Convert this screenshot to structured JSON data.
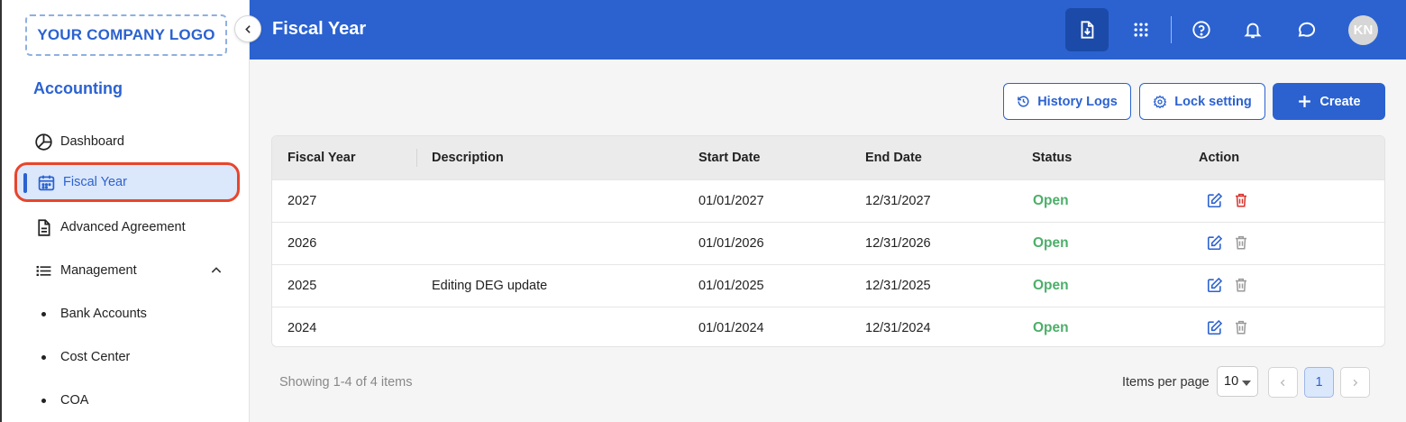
{
  "sidebar": {
    "logo": "YOUR COMPANY LOGO",
    "section_title": "Accounting",
    "items": [
      {
        "label": "Dashboard",
        "icon": "pie-chart-icon"
      },
      {
        "label": "Fiscal Year",
        "icon": "calendar-icon",
        "active": true
      },
      {
        "label": "Advanced Agreement",
        "icon": "document-icon"
      },
      {
        "label": "Management",
        "icon": "list-icon",
        "expanded": true
      }
    ],
    "sub_items": [
      {
        "label": "Bank Accounts"
      },
      {
        "label": "Cost Center"
      },
      {
        "label": "COA"
      }
    ]
  },
  "header": {
    "title": "Fiscal Year",
    "avatar_initials": "KN",
    "icons": [
      "download-icon",
      "apps-grid-icon",
      "help-icon",
      "bell-icon",
      "chat-icon"
    ]
  },
  "toolbar": {
    "history_label": "History Logs",
    "lock_label": "Lock setting",
    "create_label": "Create"
  },
  "table": {
    "columns": [
      "Fiscal Year",
      "Description",
      "Start Date",
      "End Date",
      "Status",
      "Action"
    ],
    "rows": [
      {
        "year": "2027",
        "description": "",
        "start": "01/01/2027",
        "end": "12/31/2027",
        "status": "Open",
        "delete_enabled": true
      },
      {
        "year": "2026",
        "description": "",
        "start": "01/01/2026",
        "end": "12/31/2026",
        "status": "Open",
        "delete_enabled": false
      },
      {
        "year": "2025",
        "description": "Editing DEG update",
        "start": "01/01/2025",
        "end": "12/31/2025",
        "status": "Open",
        "delete_enabled": false
      },
      {
        "year": "2024",
        "description": "",
        "start": "01/01/2024",
        "end": "12/31/2024",
        "status": "Open",
        "delete_enabled": false
      }
    ]
  },
  "footer": {
    "showing": "Showing 1-4 of 4 items",
    "items_per_page_label": "Items per page",
    "items_per_page_value": "10",
    "current_page": "1"
  },
  "colors": {
    "primary": "#2b62d0",
    "status_open": "#4caf6a",
    "delete_active": "#d8322b",
    "highlight_border": "#e8452c"
  }
}
